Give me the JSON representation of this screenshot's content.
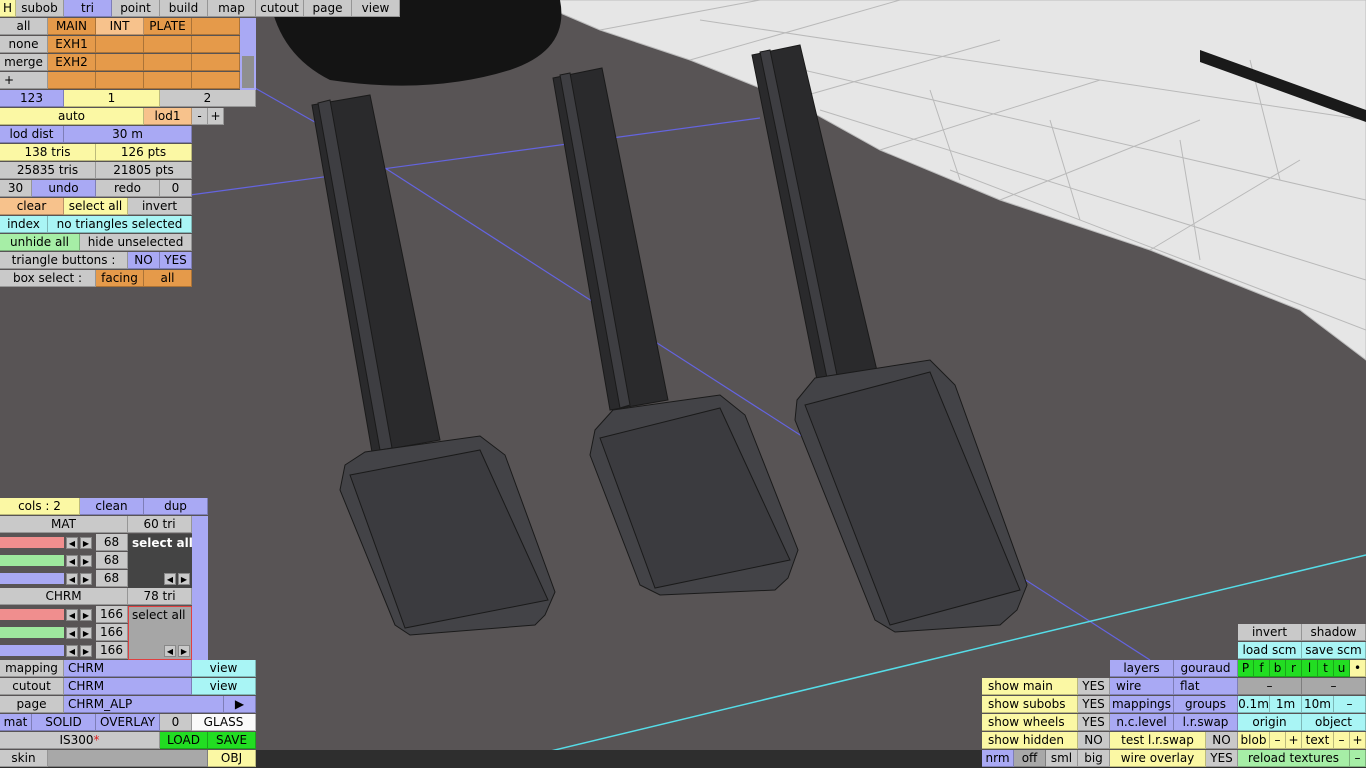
{
  "app": {
    "name": "3D car model editor"
  },
  "top_menu": [
    "H",
    "subob",
    "tri",
    "point",
    "build",
    "map",
    "cutout",
    "page",
    "view"
  ],
  "subob_panel": {
    "rows": [
      {
        "left": "all",
        "cells": [
          "MAIN",
          "INT",
          "PLATE",
          ""
        ]
      },
      {
        "left": "none",
        "cells": [
          "EXH1",
          "",
          "",
          ""
        ]
      },
      {
        "left": "merge",
        "cells": [
          "EXH2",
          "",
          "",
          ""
        ]
      },
      {
        "left": "+",
        "cells": [
          "",
          "",
          "",
          ""
        ]
      }
    ],
    "tabs": [
      "123",
      "1",
      "2"
    ]
  },
  "lod": {
    "auto": "auto",
    "lod": "lod1",
    "minus": "-",
    "plus": "+",
    "lod_dist_label": "lod dist",
    "lod_dist_value": "30 m"
  },
  "stats": {
    "tris": "138 tris",
    "pts": "126 pts",
    "total_tris": "25835 tris",
    "total_pts": "21805 pts"
  },
  "history": {
    "count": "30",
    "undo": "undo",
    "redo": "redo",
    "redo_count": "0"
  },
  "selection": {
    "clear": "clear",
    "select_all": "select all",
    "invert": "invert",
    "index": "index",
    "status": "no triangles selected",
    "unhide_all": "unhide all",
    "hide_unselected": "hide unselected",
    "triangle_buttons_label": "triangle buttons :",
    "no": "NO",
    "yes": "YES",
    "box_select_label": "box select :",
    "facing": "facing",
    "all": "all"
  },
  "materials": {
    "cols": "cols : 2",
    "clean": "clean",
    "dup": "dup",
    "items": [
      {
        "name": "MAT",
        "tris": "60 tri",
        "values": [
          "68",
          "68",
          "68"
        ],
        "select_all": "select all"
      },
      {
        "name": "CHRM",
        "tris": "78 tri",
        "values": [
          "166",
          "166",
          "166"
        ],
        "select_all": "select all"
      }
    ]
  },
  "mapping": {
    "mapping_label": "mapping",
    "mapping_value": "CHRM",
    "view": "view",
    "cutout_label": "cutout",
    "cutout_value": "CHRM",
    "page_label": "page",
    "page_value": "CHRM_ALP",
    "page_arrow": "▶",
    "mat_label": "mat",
    "solid": "SOLID",
    "overlay": "OVERLAY",
    "zero": "0",
    "glass": "GLASS",
    "file": "IS300",
    "modified_mark": "*",
    "load": "LOAD",
    "save": "SAVE",
    "skin": "skin",
    "obj": "OBJ"
  },
  "view_panel": {
    "invert": "invert",
    "shadow": "shadow",
    "load_scm": "load scm",
    "save_scm": "save scm",
    "layers": "layers",
    "gouraud": "gouraud",
    "flags": [
      "P",
      "f",
      "b",
      "r",
      "l",
      "t",
      "u",
      "•"
    ],
    "wire": "wire",
    "flat": "flat",
    "dash": "–",
    "show_main": "show main",
    "show_subobs": "show subobs",
    "show_wheels": "show wheels",
    "show_hidden": "show hidden",
    "yes": "YES",
    "no": "NO",
    "mappings": "mappings",
    "groups": "groups",
    "s01": "0.1m",
    "s1": "1m",
    "s10": "10m",
    "minus": "–",
    "nc_level": "n.c.level",
    "lr_swap": "l.r.swap",
    "origin": "origin",
    "object": "object",
    "test_lr_swap": "test l.r.swap",
    "blob": "blob",
    "text": "text",
    "m": "–",
    "p": "+",
    "nrm": "nrm",
    "off": "off",
    "sml": "sml",
    "big": "big",
    "wire_overlay": "wire overlay",
    "reload_textures": "reload textures"
  }
}
